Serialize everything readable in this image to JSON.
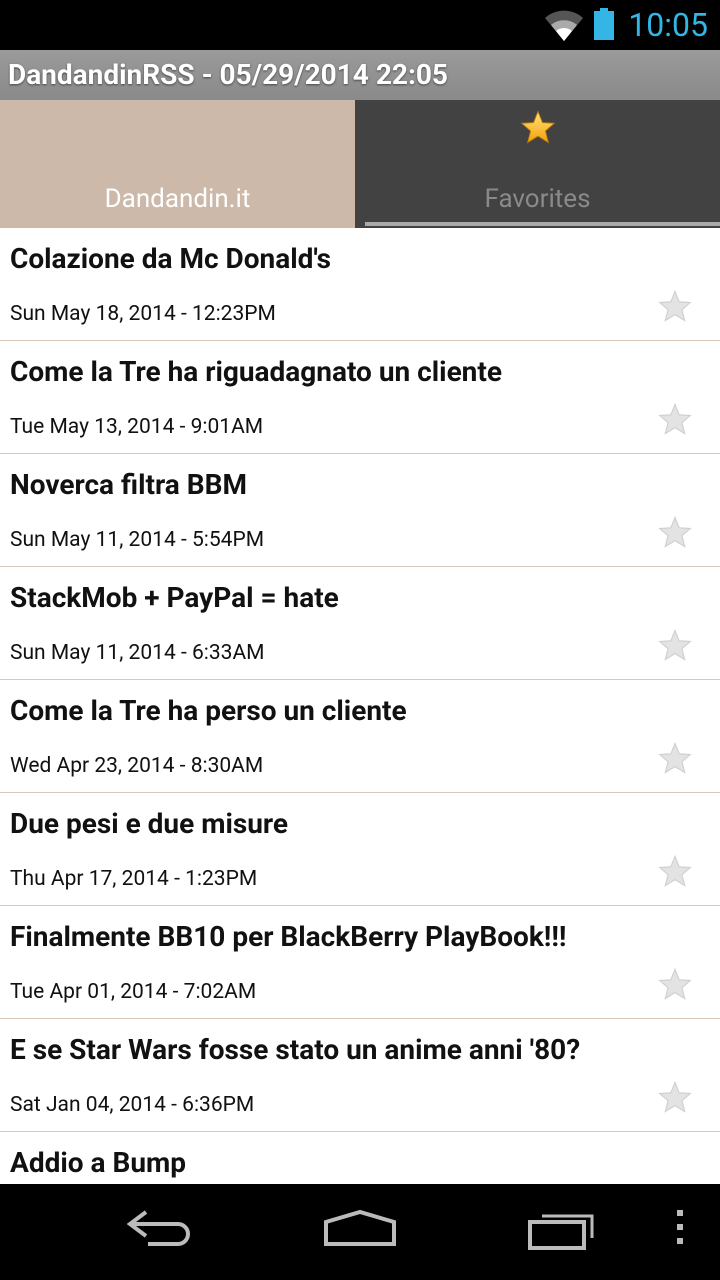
{
  "status_bar": {
    "time": "10:05",
    "accent_color": "#33b5e5",
    "icons": [
      "wifi-icon",
      "battery-icon"
    ]
  },
  "app_title": "DandandinRSS - 05/29/2014 22:05",
  "tabs": [
    {
      "label": "Dandandin.it",
      "selected": true
    },
    {
      "label": "Favorites",
      "selected": false,
      "icon": "star-icon"
    }
  ],
  "items": [
    {
      "title": "Colazione da Mc Donald's",
      "date": "Sun May 18, 2014 - 12:23PM"
    },
    {
      "title": "Come la Tre ha riguadagnato un cliente",
      "date": "Tue May 13, 2014 - 9:01AM"
    },
    {
      "title": "Noverca filtra BBM",
      "date": "Sun May 11, 2014 - 5:54PM"
    },
    {
      "title": "StackMob + PayPal = hate",
      "date": "Sun May 11, 2014 - 6:33AM"
    },
    {
      "title": "Come la Tre ha perso un cliente",
      "date": "Wed Apr 23, 2014 - 8:30AM"
    },
    {
      "title": "Due pesi e due misure",
      "date": "Thu Apr 17, 2014 - 1:23PM"
    },
    {
      "title": "Finalmente BB10 per BlackBerry PlayBook!!!",
      "date": "Tue Apr 01, 2014 - 7:02AM"
    },
    {
      "title": "E se Star Wars fosse stato un anime anni '80?",
      "date": "Sat Jan 04, 2014 - 6:36PM"
    },
    {
      "title": "Addio a Bump",
      "date": ""
    }
  ],
  "nav_bar": {
    "buttons": [
      "back-icon",
      "home-icon",
      "recent-apps-icon",
      "overflow-menu-icon"
    ]
  }
}
